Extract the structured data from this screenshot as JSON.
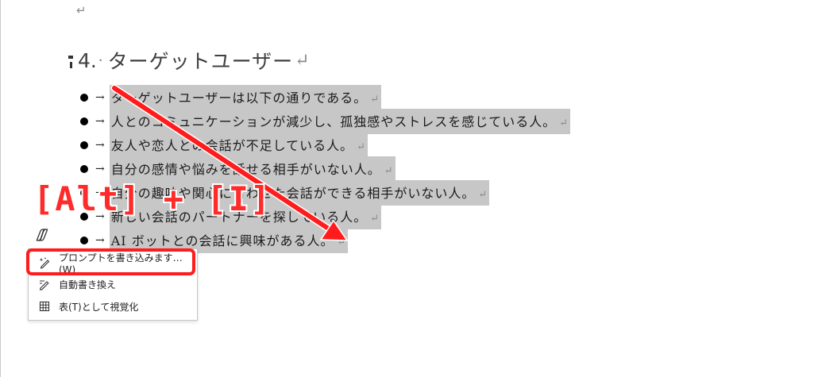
{
  "document": {
    "empty_para_mark": "↵",
    "heading": {
      "number": "4.",
      "dot": "·",
      "text": "ターゲットユーザー",
      "return_mark": "↵"
    },
    "bullets": [
      {
        "arrow": "→",
        "text": "ターゲットユーザーは以下の通りである。",
        "return_mark": "↵"
      },
      {
        "arrow": "→",
        "text": "人とのコミュニケーションが減少し、孤独感やストレスを感じている人。",
        "return_mark": "↵"
      },
      {
        "arrow": "→",
        "text": "友人や恋人との会話が不足している人。",
        "return_mark": "↵"
      },
      {
        "arrow": "→",
        "text": "自分の感情や悩みを話せる相手がいない人。",
        "return_mark": "↵"
      },
      {
        "arrow": "→",
        "text": "自分の趣味や関心に合わせた会話ができる相手がいない人。",
        "return_mark": "↵"
      },
      {
        "arrow": "→",
        "text": "新しい会話のパートナーを探している人。",
        "return_mark": "↵"
      },
      {
        "arrow": "→",
        "text": "AI ボットとの会話に興味がある人。",
        "return_mark": "↵"
      }
    ]
  },
  "context_menu": {
    "items": [
      {
        "label": "プロンプトを書き込みます…(W)",
        "icon": "sparkle-pen-icon"
      },
      {
        "label": "自動書き換え",
        "icon": "pencil-rewrite-icon"
      },
      {
        "label": "表(T)として視覚化",
        "icon": "table-grid-icon"
      }
    ]
  },
  "annotation": {
    "shortcut": "[Alt] + [I]",
    "color": "#ff2a2a"
  }
}
